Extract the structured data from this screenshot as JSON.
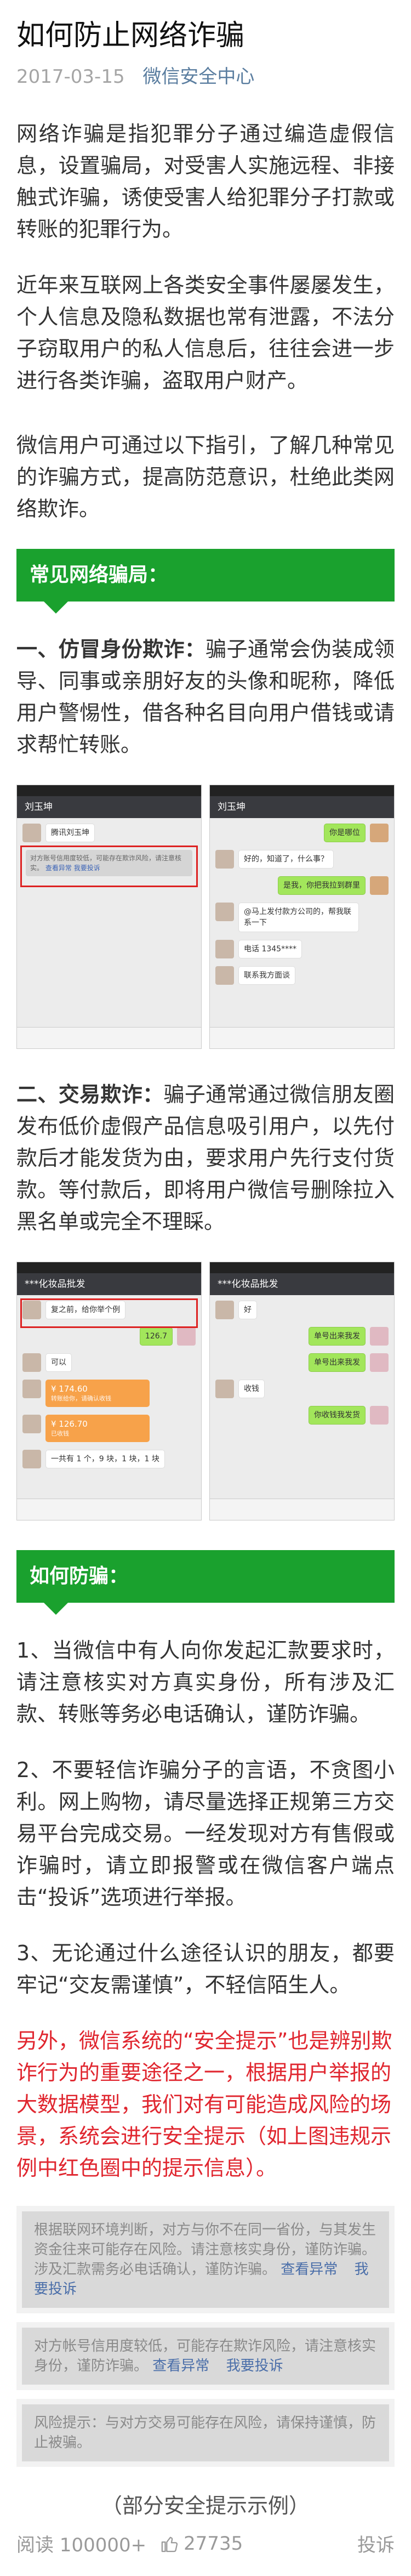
{
  "article": {
    "title": "如何防止网络诈骗",
    "date": "2017-03-15",
    "account": "微信安全中心",
    "intro": [
      "网络诈骗是指犯罪分子通过编造虚假信息，设置骗局，对受害人实施远程、非接触式诈骗，诱使受害人给犯罪分子打款或转账的犯罪行为。",
      "近年来互联网上各类安全事件屡屡发生，个人信息及隐私数据也常有泄露，不法分子窃取用户的私人信息后，往往会进一步进行各类诈骗，盗取用户财产。",
      "微信用户可通过以下指引，了解几种常见的诈骗方式，提高防范意识，杜绝此类网络欺诈。"
    ]
  },
  "section_common": {
    "heading": "常见网络骗局：",
    "item1_title": "一、仿冒身份欺诈：",
    "item1_body": "骗子通常会伪装成领导、同事或亲朋好友的头像和昵称，降低用户警惕性，借各种名目向用户借钱或请求帮忙转账。",
    "item2_title": "二、交易欺诈：",
    "item2_body": "骗子通常通过微信朋友圈发布低价虚假产品信息吸引用户，以先付款后才能发货为由，要求用户先行支付货款。等付款后，即将用户微信号删除拉入黑名单或完全不理睬。"
  },
  "shots": {
    "shot1_left": {
      "nav": "刘玉坤",
      "msg1": "腾讯刘玉坤",
      "sys": "对方账号信用度较低，可能存在欺诈风险，请注意核实。",
      "sys_links": [
        "查看异常",
        "我要投诉"
      ]
    },
    "shot1_right": {
      "nav": "刘玉坤",
      "msg1": "你是哪位",
      "msg2": "好的，知道了，什么事？",
      "msg3": "是我，你把我拉到群里",
      "msg4": "@马上发付款方公司的，帮我联系一下",
      "msg5": "联系我方面谈",
      "msg6": "电话 1345****"
    },
    "shot2_left": {
      "nav": "***化妆品批发",
      "msg1": "复之前，给你举个例",
      "amount": "126.7",
      "msg2": "可以",
      "transfer1_amt": "¥ 174.60",
      "transfer1_lab": "转账给你，请确认收钱",
      "transfer2_amt": "¥ 126.70",
      "transfer2_lab": "已收钱",
      "msg3": "一共有 1 个，9 块，1 块，1 块"
    },
    "shot2_right": {
      "nav": "***化妆品批发",
      "msg1": "好",
      "msg2": "单号出来我发",
      "msg3": "单号出来我发",
      "msg4": "收钱",
      "msg5": "你收钱我发货"
    }
  },
  "section_prevent": {
    "heading": "如何防骗：",
    "p1": "1、当微信中有人向你发起汇款要求时，请注意核实对方真实身份，所有涉及汇款、转账等务必电话确认，谨防诈骗。",
    "p2": "2、不要轻信诈骗分子的言语，不贪图小利。网上购物，请尽量选择正规第三方交易平台完成交易。一经发现对方有售假或诈骗时，请立即报警或在微信客户端点击“投诉”选项进行举报。",
    "p3": "3、无论通过什么途径认识的朋友，都要牢记“交友需谨慎”，不轻信陌生人。",
    "warning": "另外，微信系统的“安全提示”也是辨别欺诈行为的重要途径之一，根据用户举报的大数据模型，我们对有可能造成风险的场景，系统会进行安全提示（如上图违规示例中红色圈中的提示信息）。"
  },
  "tips": [
    {
      "text": "根据联网环境判断，对方与你不在同一省份，与其发生资金往来可能存在风险。请注意核实身份，谨防诈骗。涉及汇款需务必电话确认，谨防诈骗。",
      "links": [
        "查看异常",
        "我要投诉"
      ]
    },
    {
      "text": "对方帐号信用度较低，可能存在欺诈风险，请注意核实身份，谨防诈骗。",
      "links": [
        "查看异常",
        "我要投诉"
      ]
    },
    {
      "text": "风险提示：与对方交易可能存在风险，请保持谨慎，防止被骗。",
      "links": []
    }
  ],
  "caption": "（部分安全提示示例）",
  "footer": {
    "reads_label": "阅读 100000+",
    "likes": "27735",
    "complain": "投诉"
  },
  "colors": {
    "accent_green": "#1aa12e",
    "warning_red": "#e0262f",
    "link_blue": "#5b7ea0"
  }
}
